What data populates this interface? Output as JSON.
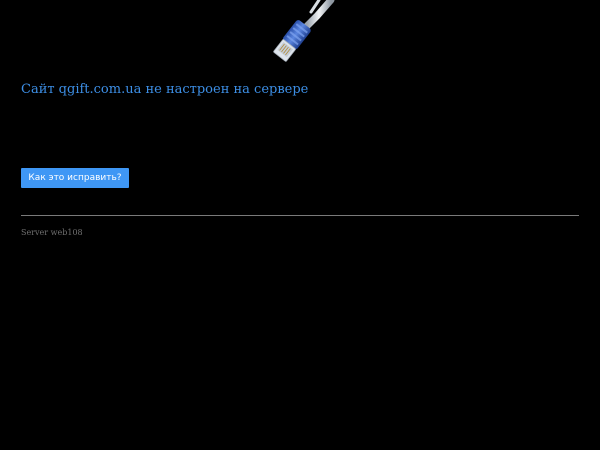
{
  "illustration": {
    "icon": "network-cable-icon"
  },
  "message": {
    "title": "Сайт qgift.com.ua не настроен на сервере"
  },
  "actions": {
    "fix_label": "Как это исправить?"
  },
  "footer": {
    "server": "Server web108"
  },
  "colors": {
    "background": "#000000",
    "title": "#3d8fe6",
    "button": "#3f97f5",
    "divider": "#7a7a7a",
    "footer_text": "#6f6f6f"
  }
}
